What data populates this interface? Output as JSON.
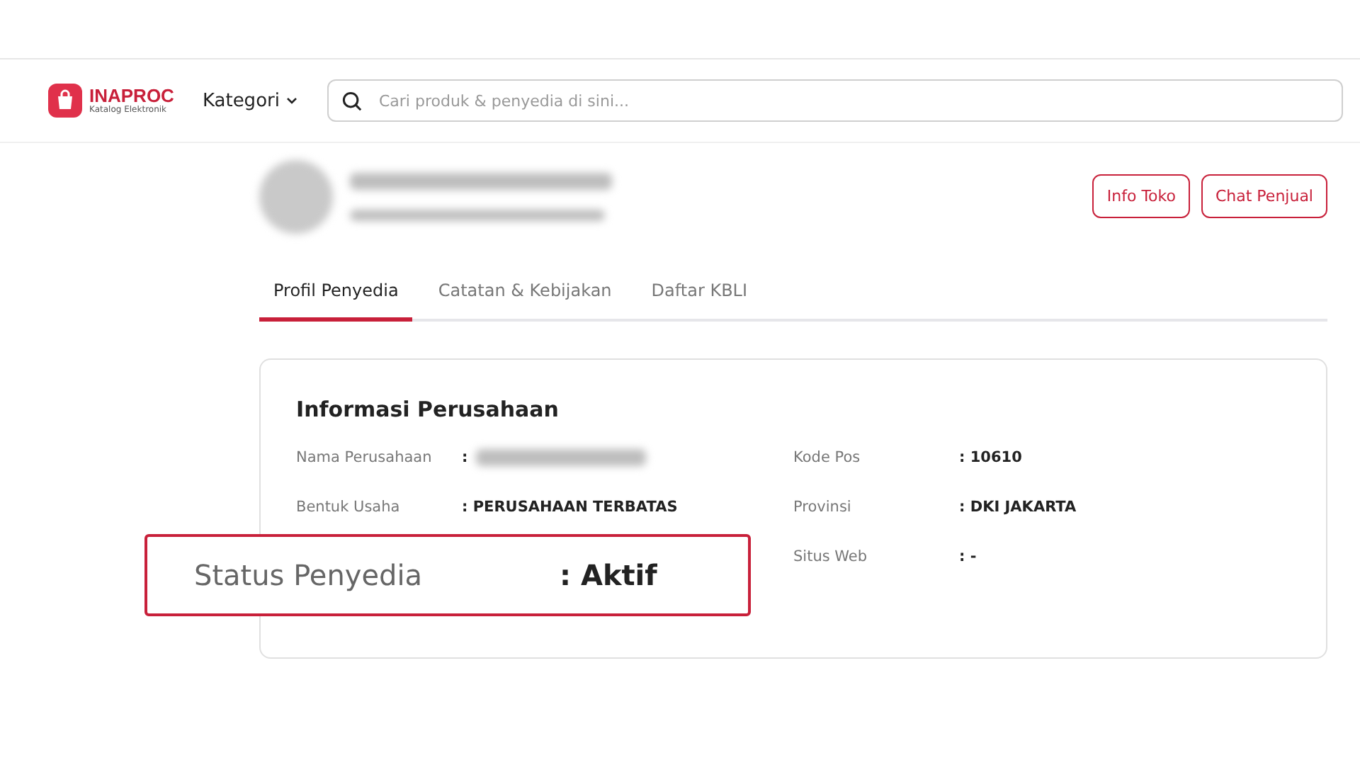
{
  "header": {
    "logo": {
      "name": "INAPROC",
      "tagline": "Katalog Elektronik"
    },
    "category_menu": "Kategori",
    "search": {
      "placeholder": "Cari produk & penyedia di sini..."
    }
  },
  "store_actions": [
    "Info Toko",
    "Chat Penjual"
  ],
  "tabs": [
    {
      "label": "Profil Penyedia",
      "selected": true
    },
    {
      "label": "Catatan & Kebijakan",
      "selected": false
    },
    {
      "label": "Daftar KBLI",
      "selected": false
    }
  ],
  "company_info": {
    "title": "Informasi Perusahaan",
    "left_fields": [
      {
        "label": "Nama Perusahaan",
        "value": ":",
        "kind": "blurred"
      },
      {
        "label": "Bentuk Usaha",
        "value": ": PERUSAHAAN TERBATAS",
        "kind": "text"
      }
    ],
    "right_fields": [
      {
        "label": "Kode Pos",
        "value": ": 10610"
      },
      {
        "label": "Provinsi",
        "value": ": DKI JAKARTA"
      },
      {
        "label": "Situs Web",
        "value": ": -"
      }
    ]
  },
  "callout": {
    "label": "Status Penyedia",
    "value": ": Aktif"
  }
}
